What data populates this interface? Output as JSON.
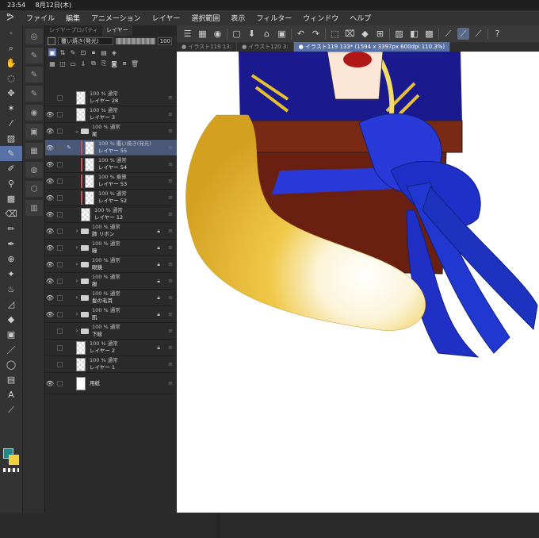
{
  "status": {
    "time": "23:54",
    "date": "8月12日(木)"
  },
  "menu": [
    "ファイル",
    "編集",
    "アニメーション",
    "レイヤー",
    "選択範囲",
    "表示",
    "フィルター",
    "ウィンドウ",
    "ヘルプ"
  ],
  "tabs": [
    {
      "label": "イラスト119 13:",
      "active": false
    },
    {
      "label": "イラスト120 3:",
      "active": false
    },
    {
      "label": "イラスト119 133* (1594 x 3397px 600dpi 110.3%)",
      "active": true
    }
  ],
  "panel": {
    "tabs": [
      "レイヤープロパティ",
      "レイヤー"
    ],
    "blend_mode": "覆い焼き(発光)",
    "opacity": "100"
  },
  "layers": [
    {
      "meta": "100 % 通常",
      "name": "レイヤー 28",
      "visible": false,
      "kind": "raster",
      "indent": false,
      "clip": false,
      "lock": false,
      "selected": false
    },
    {
      "meta": "100 % 通常",
      "name": "レイヤー 3",
      "visible": true,
      "kind": "raster",
      "indent": false,
      "clip": false,
      "lock": false,
      "selected": false
    },
    {
      "meta": "100 % 通常",
      "name": "尾",
      "visible": true,
      "kind": "folder-open",
      "indent": false,
      "clip": false,
      "lock": false,
      "selected": false
    },
    {
      "meta": "100 % 覆い焼き(発光)",
      "name": "レイヤー 55",
      "visible": true,
      "kind": "raster",
      "indent": true,
      "clip": true,
      "lock": false,
      "selected": true
    },
    {
      "meta": "100 % 通常",
      "name": "レイヤー 54",
      "visible": true,
      "kind": "raster",
      "indent": true,
      "clip": true,
      "lock": false,
      "selected": false
    },
    {
      "meta": "100 % 乗算",
      "name": "レイヤー 53",
      "visible": true,
      "kind": "raster",
      "indent": true,
      "clip": true,
      "lock": false,
      "selected": false
    },
    {
      "meta": "100 % 通常",
      "name": "レイヤー 52",
      "visible": true,
      "kind": "raster",
      "indent": true,
      "clip": true,
      "lock": false,
      "selected": false
    },
    {
      "meta": "100 % 通常",
      "name": "レイヤー 12",
      "visible": true,
      "kind": "raster",
      "indent": true,
      "clip": false,
      "lock": false,
      "selected": false
    },
    {
      "meta": "100 % 通常",
      "name": "肺 リボン",
      "visible": true,
      "kind": "folder",
      "indent": false,
      "clip": false,
      "lock": true,
      "selected": false
    },
    {
      "meta": "100 % 通常",
      "name": "瞳",
      "visible": true,
      "kind": "folder",
      "indent": false,
      "clip": false,
      "lock": true,
      "selected": false
    },
    {
      "meta": "100 % 通常",
      "name": "眼鏡",
      "visible": true,
      "kind": "folder",
      "indent": false,
      "clip": false,
      "lock": true,
      "selected": false
    },
    {
      "meta": "100 % 通常",
      "name": "服",
      "visible": true,
      "kind": "folder",
      "indent": false,
      "clip": false,
      "lock": true,
      "selected": false
    },
    {
      "meta": "100 % 通常",
      "name": "髪の毛耳",
      "visible": true,
      "kind": "folder",
      "indent": false,
      "clip": false,
      "lock": true,
      "selected": false
    },
    {
      "meta": "100 % 通常",
      "name": "肌",
      "visible": true,
      "kind": "folder",
      "indent": false,
      "clip": false,
      "lock": true,
      "selected": false
    },
    {
      "meta": "100 % 通常",
      "name": "下絵",
      "visible": false,
      "kind": "folder",
      "indent": false,
      "clip": false,
      "lock": false,
      "selected": false
    },
    {
      "meta": "100 % 通常",
      "name": "レイヤー 2",
      "visible": false,
      "kind": "raster",
      "indent": false,
      "clip": false,
      "lock": true,
      "selected": false
    },
    {
      "meta": "100 % 通常",
      "name": "レイヤー 1",
      "visible": false,
      "kind": "raster",
      "indent": false,
      "clip": false,
      "lock": false,
      "selected": false
    },
    {
      "meta": "",
      "name": "用紙",
      "visible": true,
      "kind": "paper",
      "indent": false,
      "clip": false,
      "lock": false,
      "selected": false
    }
  ],
  "colors": {
    "main": "#1f8a8a",
    "sub": "#f0d040",
    "accent": "#5872a8"
  }
}
